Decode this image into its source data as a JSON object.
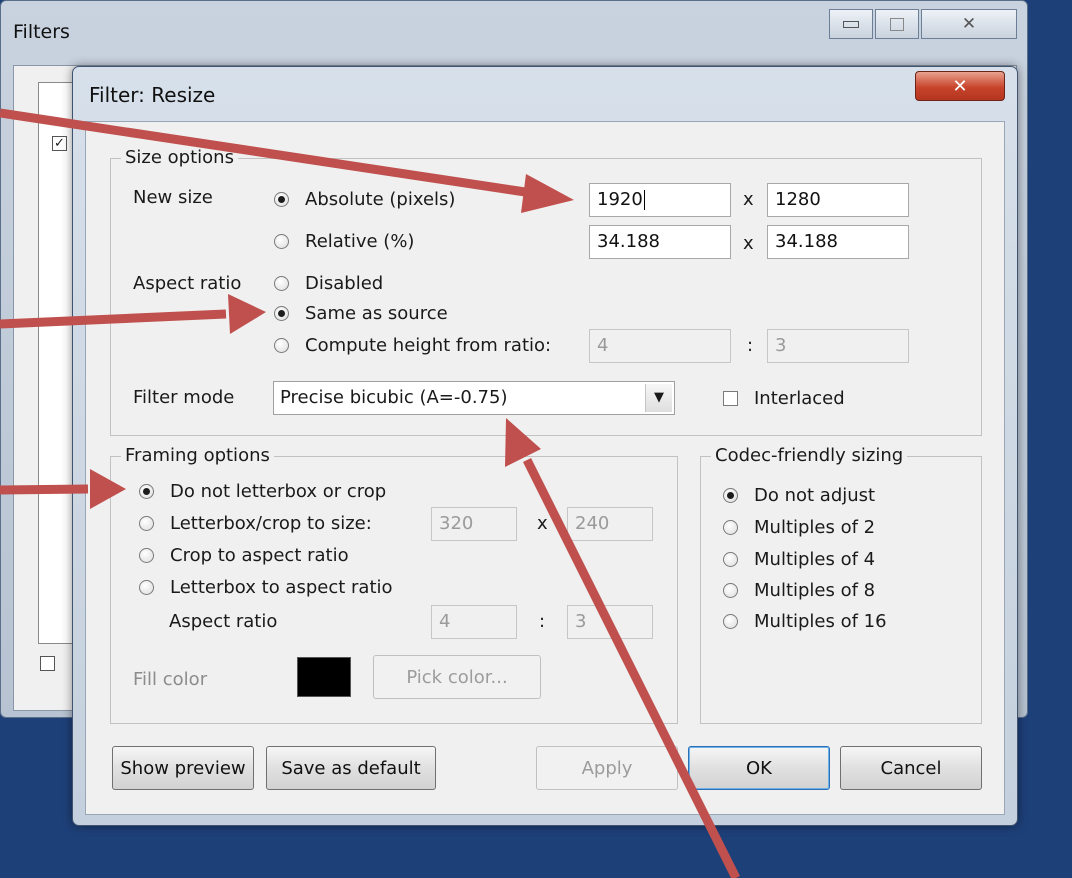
{
  "background_window": {
    "title": "Filters",
    "minimize_icon": "minimize-icon",
    "maximize_icon": "maximize-icon",
    "close_icon": "close-icon"
  },
  "dialog": {
    "title": "Filter: Resize",
    "close_icon": "close-icon",
    "size_options": {
      "legend": "Size options",
      "new_size_label": "New size",
      "absolute_label": "Absolute (pixels)",
      "absolute_width": "1920",
      "absolute_height": "1280",
      "relative_label": "Relative (%)",
      "relative_width": "34.188",
      "relative_height": "34.188",
      "x_sep": "x",
      "aspect_ratio_label": "Aspect ratio",
      "disabled_label": "Disabled",
      "same_as_source_label": "Same as source",
      "compute_height_label": "Compute height from ratio:",
      "ratio_num": "4",
      "ratio_den": "3",
      "colon_sep": ":",
      "filter_mode_label": "Filter mode",
      "filter_mode_value": "Precise bicubic (A=-0.75)",
      "interlaced_label": "Interlaced",
      "interlaced_checked": false
    },
    "framing_options": {
      "legend": "Framing options",
      "no_letterbox_label": "Do not letterbox or crop",
      "letterbox_size_label": "Letterbox/crop to size:",
      "letterbox_width": "320",
      "letterbox_height": "240",
      "crop_aspect_label": "Crop to aspect ratio",
      "letterbox_aspect_label": "Letterbox to aspect ratio",
      "aspect_ratio_label": "Aspect ratio",
      "aspect_num": "4",
      "aspect_den": "3",
      "fill_color_label": "Fill color",
      "fill_color": "#000000",
      "pick_color_label": "Pick color..."
    },
    "codec_sizing": {
      "legend": "Codec-friendly sizing",
      "options": [
        "Do not adjust",
        "Multiples of 2",
        "Multiples of 4",
        "Multiples of 8",
        "Multiples of 16"
      ],
      "selected": "Do not adjust"
    },
    "buttons": {
      "show_preview": "Show preview",
      "save_default": "Save as default",
      "apply": "Apply",
      "ok": "OK",
      "cancel": "Cancel"
    }
  },
  "annotation_color": "#c0504d"
}
